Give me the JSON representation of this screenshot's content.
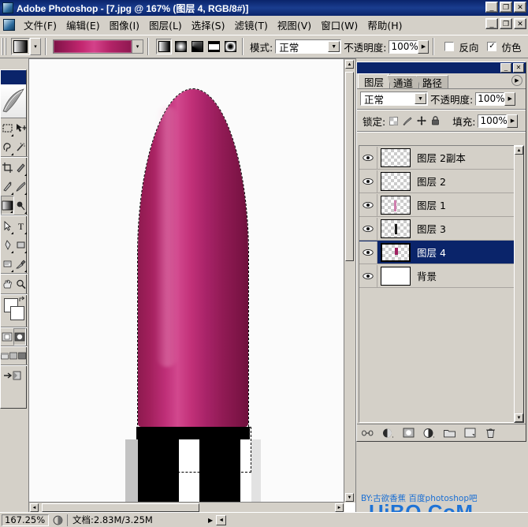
{
  "window": {
    "title": "Adobe Photoshop - [7.jpg @ 167% (图层 4, RGB/8#)]",
    "app_icon": "photoshop-icon",
    "minimize": "_",
    "maximize": "❐",
    "close": "✕"
  },
  "menubar": {
    "doc_icon": "document-icon",
    "items": [
      {
        "label": "文件(F)"
      },
      {
        "label": "编辑(E)"
      },
      {
        "label": "图像(I)"
      },
      {
        "label": "图层(L)"
      },
      {
        "label": "选择(S)"
      },
      {
        "label": "滤镜(T)"
      },
      {
        "label": "视图(V)"
      },
      {
        "label": "窗口(W)"
      },
      {
        "label": "帮助(H)"
      }
    ],
    "minimize": "_",
    "restore": "❐",
    "close": "✕"
  },
  "options_bar": {
    "tool": "gradient-tool",
    "tool_preset_arrow": "▾",
    "gradient_preview_colors": [
      "#7d1246",
      "#c2266f",
      "#d4428a",
      "#b42468",
      "#8e1850"
    ],
    "gradient_picker_arrow": "▾",
    "gradient_types": [
      {
        "name": "linear-gradient-type",
        "selected": true
      },
      {
        "name": "radial-gradient-type",
        "selected": false
      },
      {
        "name": "angle-gradient-type",
        "selected": false
      },
      {
        "name": "reflected-gradient-type",
        "selected": false
      },
      {
        "name": "diamond-gradient-type",
        "selected": false
      }
    ],
    "mode_label": "模式:",
    "mode_value": "正常",
    "opacity_label": "不透明度:",
    "opacity_value": "100%",
    "reverse_label": "反向",
    "reverse_checked": false,
    "dither_label": "仿色",
    "dither_checked": true,
    "checkmark": "✓"
  },
  "toolbox": {
    "tools": [
      {
        "name": "marquee-tool"
      },
      {
        "name": "move-tool"
      },
      {
        "name": "lasso-tool"
      },
      {
        "name": "magic-wand-tool"
      },
      {
        "name": "crop-tool"
      },
      {
        "name": "slice-tool"
      },
      {
        "name": "healing-brush-tool"
      },
      {
        "name": "brush-tool"
      },
      {
        "name": "stamp-tool"
      },
      {
        "name": "history-brush-tool"
      },
      {
        "name": "eraser-tool"
      },
      {
        "name": "gradient-tool"
      },
      {
        "name": "blur-tool"
      },
      {
        "name": "dodge-tool"
      },
      {
        "name": "path-selection-tool"
      },
      {
        "name": "type-tool"
      },
      {
        "name": "pen-tool"
      },
      {
        "name": "shape-tool"
      },
      {
        "name": "notes-tool"
      },
      {
        "name": "eyedropper-tool"
      },
      {
        "name": "hand-tool"
      },
      {
        "name": "zoom-tool"
      }
    ],
    "selected_tool": "gradient-tool",
    "foreground_color": "#ffffff",
    "background_color": "#ffffff",
    "quickmask_standard": "standard-mode",
    "quickmask_mask": "quickmask-mode",
    "screen_modes": [
      "standard-screen-mode",
      "full-screen-menu-mode",
      "full-screen-mode"
    ],
    "jump_to_imageready": "jump-to-imageready"
  },
  "document": {
    "zoom": "167.25%",
    "info_icon": "proxy-preview-icon",
    "doc_size": "文档:2.83M/3.25M",
    "status_arrow": "▶",
    "scroll_arrow": "◄"
  },
  "layers_panel": {
    "title_minimize": "_",
    "title_close": "✕",
    "menu_icon": "panel-menu-icon",
    "tabs": [
      {
        "label": "图层",
        "active": true
      },
      {
        "label": "通道",
        "active": false
      },
      {
        "label": "路径",
        "active": false
      }
    ],
    "blend_mode": "正常",
    "blend_mode_arrow": "▾",
    "opacity_label": "不透明度:",
    "opacity_value": "100%",
    "lock_label": "锁定:",
    "lock_icons": [
      "lock-transparent-pixels-icon",
      "lock-image-pixels-icon",
      "lock-position-icon",
      "lock-all-icon"
    ],
    "fill_label": "填充:",
    "fill_value": "100%",
    "spin_arrow": "▶",
    "layers": [
      {
        "name": "图层 2副本",
        "visible": true,
        "selected": false,
        "thumb": "transparent"
      },
      {
        "name": "图层 2",
        "visible": true,
        "selected": false,
        "thumb": "transparent"
      },
      {
        "name": "图层 1",
        "visible": true,
        "selected": false,
        "thumb": "transparent"
      },
      {
        "name": "图层 3",
        "visible": true,
        "selected": false,
        "thumb": "transparent"
      },
      {
        "name": "图层 4",
        "visible": true,
        "selected": true,
        "thumb": "transparent"
      },
      {
        "name": "背景",
        "visible": true,
        "selected": false,
        "thumb": "white"
      }
    ],
    "footer_buttons": [
      {
        "name": "link-layers-button"
      },
      {
        "name": "layer-style-button"
      },
      {
        "name": "layer-mask-button"
      },
      {
        "name": "adjustment-layer-button"
      },
      {
        "name": "new-group-button"
      },
      {
        "name": "new-layer-button"
      },
      {
        "name": "delete-layer-button"
      }
    ]
  },
  "watermark": {
    "line1": "BY:古欲香蕉  百度photoshop吧",
    "line2": "UiBQ.CoM"
  },
  "colors": {
    "title_blue": "#0a246a",
    "chrome_gray": "#d4d0c8",
    "selection_blue": "#0a246a",
    "lipstick_magenta": "#b42468",
    "watermark_blue": "#1e73d6"
  }
}
